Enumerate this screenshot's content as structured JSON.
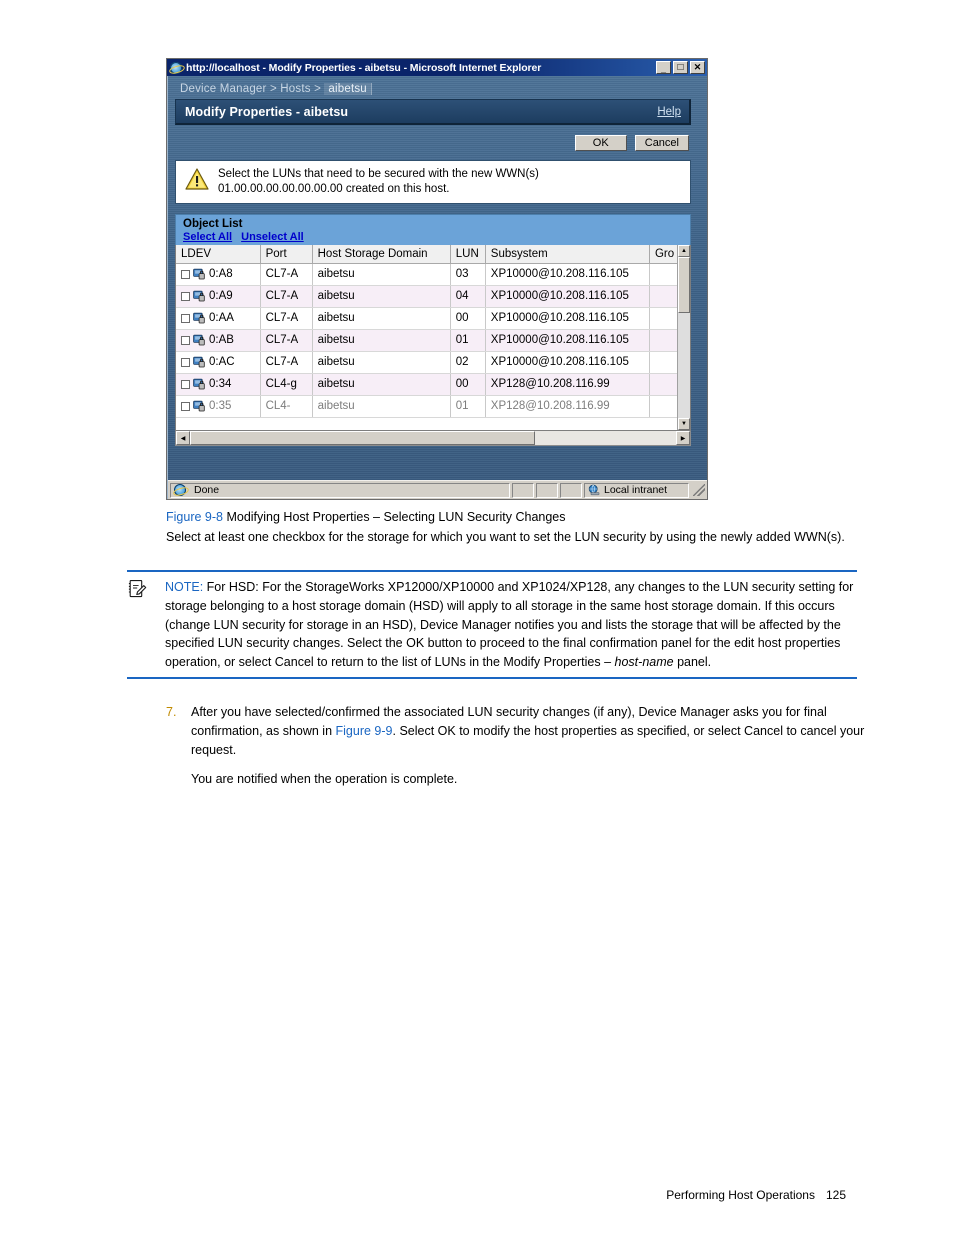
{
  "screenshot": {
    "titlebar": {
      "text": "http://localhost - Modify Properties - aibetsu - Microsoft Internet Explorer",
      "icon": "ie-globe-icon",
      "minimize": "_",
      "maximize": "□",
      "close": "✕"
    },
    "breadcrumb": {
      "root": "Device Manager",
      "sep1": ">",
      "level2": "Hosts",
      "sep2": ">",
      "current": "aibetsu",
      "full": "Device Manager > Hosts > aibetsu"
    },
    "panel": {
      "title": "Modify Properties - aibetsu",
      "help": "Help"
    },
    "buttons": {
      "ok": "OK",
      "cancel": "Cancel"
    },
    "message": {
      "icon": "warning-triangle-icon",
      "line1": "Select the LUNs that need to be secured with the new WWN(s)",
      "line2": "01.00.00.00.00.00.00.00 created on this host."
    },
    "object_list": {
      "heading": "Object List",
      "select_all": "Select All",
      "unselect_all": "Unselect All"
    },
    "table": {
      "columns": [
        "LDEV",
        "Port",
        "Host Storage Domain",
        "LUN",
        "Subsystem",
        "Gro"
      ],
      "rows": [
        {
          "ldev": "0:A8",
          "port": "CL7-A",
          "hsd": "aibetsu",
          "lun": "03",
          "subsystem": "XP10000@10.208.116.105",
          "group": ""
        },
        {
          "ldev": "0:A9",
          "port": "CL7-A",
          "hsd": "aibetsu",
          "lun": "04",
          "subsystem": "XP10000@10.208.116.105",
          "group": ""
        },
        {
          "ldev": "0:AA",
          "port": "CL7-A",
          "hsd": "aibetsu",
          "lun": "00",
          "subsystem": "XP10000@10.208.116.105",
          "group": ""
        },
        {
          "ldev": "0:AB",
          "port": "CL7-A",
          "hsd": "aibetsu",
          "lun": "01",
          "subsystem": "XP10000@10.208.116.105",
          "group": ""
        },
        {
          "ldev": "0:AC",
          "port": "CL7-A",
          "hsd": "aibetsu",
          "lun": "02",
          "subsystem": "XP10000@10.208.116.105",
          "group": ""
        },
        {
          "ldev": "0:34",
          "port": "CL4-g",
          "hsd": "aibetsu",
          "lun": "00",
          "subsystem": "XP128@10.208.116.99",
          "group": ""
        },
        {
          "ldev": "0:35",
          "port": "CL4-",
          "hsd": "aibetsu",
          "lun": "01",
          "subsystem": "XP128@10.208.116.99",
          "group": ""
        }
      ]
    },
    "statusbar": {
      "text": "Done",
      "icon": "ie-globe-icon",
      "zone": "Local intranet",
      "zone_icon": "network-globe-icon"
    }
  },
  "figure": {
    "ref": "Figure 9-8",
    "caption": " Modifying Host Properties – Selecting LUN Security Changes",
    "description": "Select at least one checkbox for the storage for which you want to set the LUN security by using the newly added WWN(s)."
  },
  "note": {
    "icon": "note-pad-pencil-icon",
    "label": "NOTE:",
    "text_part1": " For HSD: For the StorageWorks XP12000/XP10000 and XP1024/XP128, any changes to the LUN security setting for storage belonging to a host storage domain (HSD) will apply to all storage in the same host storage domain. If this occurs (change LUN security for storage in an HSD), Device Manager notifies you and lists the storage that will be affected by the specified LUN security changes. Select the OK button to proceed to the final confirmation panel for the edit host properties operation, or select Cancel to return to the list of LUNs in the Modify Properties – ",
    "text_italic": "host-name",
    "text_part2": " panel."
  },
  "step": {
    "number": "7.",
    "text_part1": "After you have selected/confirmed the associated LUN security changes (if any), Device Manager asks you for final confirmation, as shown in ",
    "ref": "Figure 9-9",
    "text_part2": ". Select OK to modify the host properties as specified, or select Cancel to cancel your request.",
    "subtext": "You are notified when the operation is complete."
  },
  "footer": {
    "section": "Performing Host Operations",
    "page": "125"
  },
  "colors": {
    "link": "#1a66c2",
    "note_rule": "#1a66c2",
    "object_list_band": "#6ba3d8",
    "panel_header": "#1d3d60",
    "titlebar": "#0a246a",
    "row_alt": "#f7eef7"
  }
}
